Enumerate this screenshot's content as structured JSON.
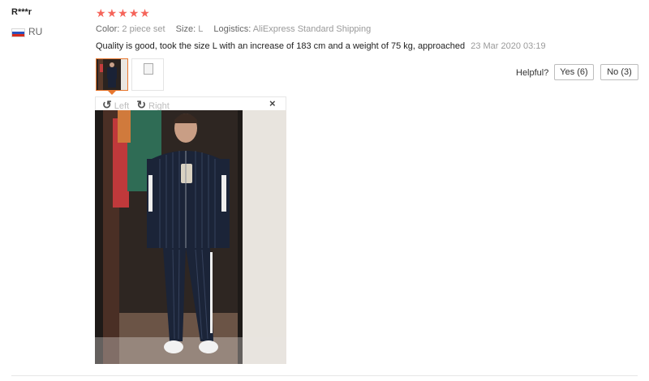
{
  "reviewer": {
    "name": "R***r",
    "country": "RU"
  },
  "rating": {
    "stars": 5,
    "max": 5,
    "star_glyph": "★",
    "color": "#f5645a"
  },
  "attributes": {
    "color_label": "Color:",
    "color_value": "2 piece set",
    "size_label": "Size:",
    "size_value": "L",
    "logistics_label": "Logistics:",
    "logistics_value": "AliExpress Standard Shipping"
  },
  "review": {
    "text": "Quality is good, took the size L with an increase of 183 cm and a weight of 75 kg, approached",
    "date": "23 Mar 2020 03:19"
  },
  "helpful": {
    "label": "Helpful?",
    "yes": "Yes (6)",
    "no": "No (3)"
  },
  "viewer": {
    "left_label": "Left",
    "right_label": "Right",
    "close_glyph": "×"
  },
  "icons": {
    "rotate_left": "rotate-left-icon",
    "rotate_right": "rotate-right-icon",
    "close": "close-icon",
    "flag": "russia-flag-icon"
  },
  "colors": {
    "thumb_active": "#e8772e",
    "meta_value": "#9a9a9a"
  }
}
